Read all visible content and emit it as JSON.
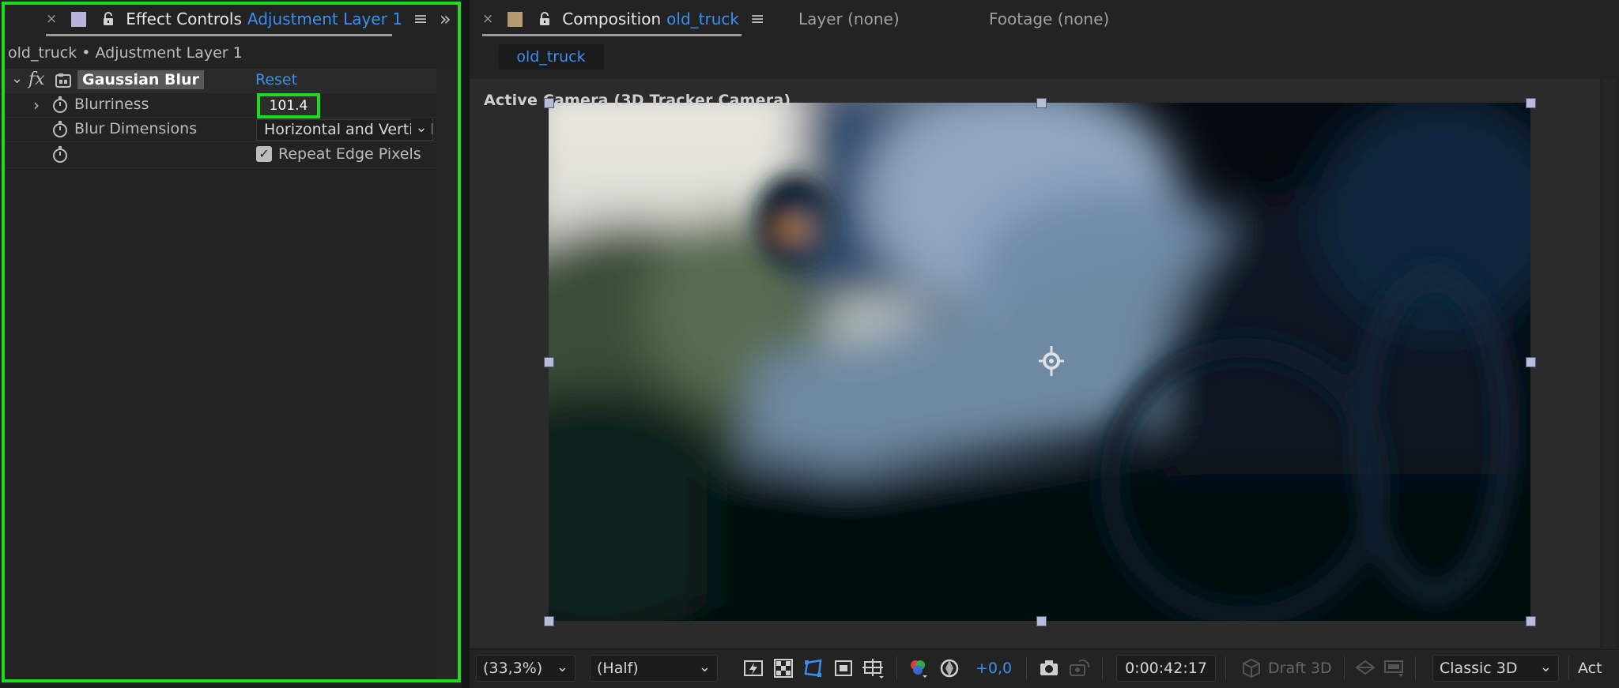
{
  "effect_controls": {
    "close_icon": "×",
    "tab_title": "Effect Controls",
    "tab_layer": "Adjustment Layer 1",
    "menu_icon": "≡",
    "overflow_icon": "»",
    "breadcrumb": "old_truck • Adjustment Layer 1",
    "effect": {
      "fx_label": "fx",
      "name": "Gaussian Blur",
      "reset_label": "Reset"
    },
    "properties": [
      {
        "label": "Blurriness",
        "value": "101.4"
      },
      {
        "label": "Blur Dimensions",
        "value": "Horizontal and Vertical"
      },
      {
        "label": "",
        "value": "Repeat Edge Pixels",
        "checked": true
      }
    ],
    "highlight_color": "#1ddb1d"
  },
  "composition": {
    "close_icon": "×",
    "tab_title": "Composition",
    "tab_comp": "old_truck",
    "menu_icon": "≡",
    "layer_tab": "Layer (none)",
    "footage_tab": "Footage (none)",
    "subtab": "old_truck",
    "camera_label": "Active Camera (3D Tracker Camera)"
  },
  "toolbar": {
    "zoom": "(33,3%)",
    "resolution": "(Half)",
    "exposure": "+0,0",
    "timecode": "0:00:42:17",
    "draft3d": "Draft 3D",
    "renderer": "Classic 3D",
    "active_label": "Act"
  },
  "colors": {
    "accent_blue": "#3b8ff0",
    "panel_bg": "#232323",
    "handle": "#b8bcd8"
  }
}
